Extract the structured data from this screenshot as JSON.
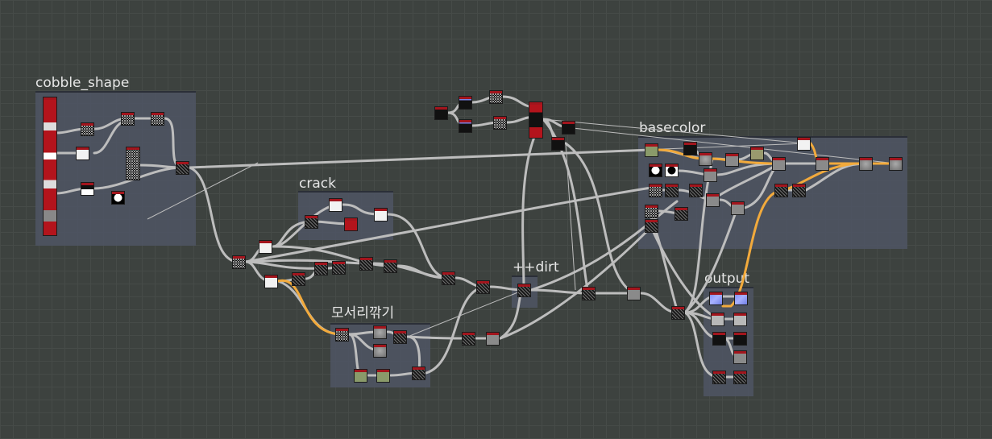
{
  "canvas": {
    "background": "#3d423f",
    "grid": "#464b48"
  },
  "colors": {
    "frame": "#4e5463",
    "wire": "#c4c4c4",
    "wire_highlight": "#f2aa3c",
    "node_header": "#a3151d"
  },
  "frames": {
    "cobble_shape": "cobble_shape",
    "crack": "crack",
    "corner": "모서리깎기",
    "dirt": "++dirt",
    "basecolor": "basecolor",
    "output": "output"
  }
}
